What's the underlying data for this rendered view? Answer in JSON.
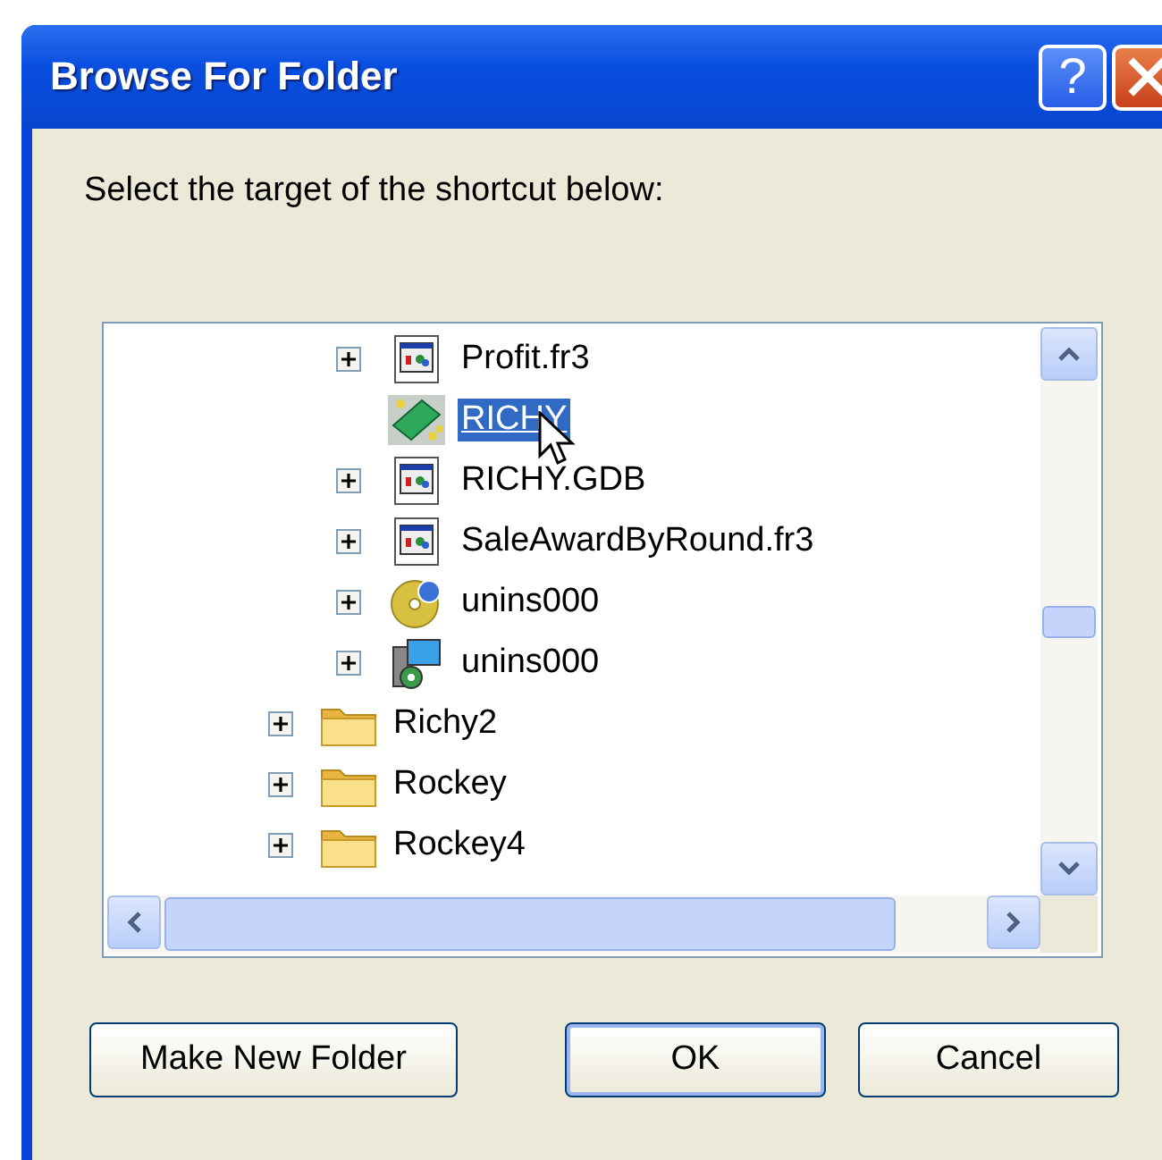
{
  "window": {
    "title": "Browse For Folder",
    "help_button": "?"
  },
  "prompt": "Select the target of the shortcut below:",
  "tree": {
    "nodes": [
      {
        "children": [
          {
            "label": "Profit.fr3",
            "kind": "report",
            "expandable": true,
            "selected": false
          },
          {
            "label": "RICHY",
            "kind": "app",
            "expandable": false,
            "selected": true
          },
          {
            "label": "RICHY.GDB",
            "kind": "report",
            "expandable": true,
            "selected": false
          },
          {
            "label": "SaleAwardByRound.fr3",
            "kind": "report",
            "expandable": true,
            "selected": false
          },
          {
            "label": "unins000",
            "kind": "disc",
            "expandable": true,
            "selected": false
          },
          {
            "label": "unins000",
            "kind": "setup",
            "expandable": true,
            "selected": false
          }
        ]
      },
      {
        "label": "Richy2",
        "kind": "folder",
        "expandable": true,
        "selected": false
      },
      {
        "label": "Rockey",
        "kind": "folder",
        "expandable": true,
        "selected": false
      },
      {
        "label": "Rockey4",
        "kind": "folder",
        "expandable": true,
        "selected": false
      }
    ]
  },
  "buttons": [
    {
      "label": "Make New Folder",
      "default": false
    },
    {
      "label": "OK",
      "default": true
    },
    {
      "label": "Cancel",
      "default": false
    }
  ]
}
